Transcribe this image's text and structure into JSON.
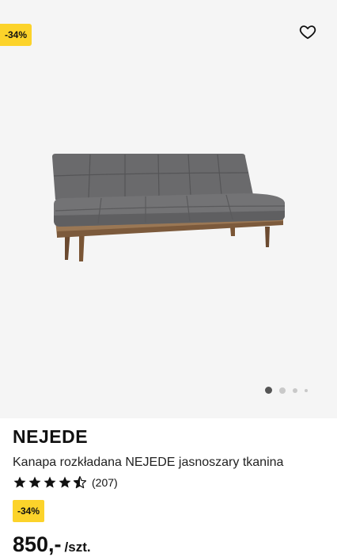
{
  "product": {
    "discount_badge": "-34%",
    "name": "NEJEDE",
    "description": "Kanapa rozkładana NEJEDE jasnoszary tkanina",
    "rating": 4.5,
    "review_count": "(207)",
    "price_badge": "-34%",
    "price": "850,-",
    "unit": "/szt."
  },
  "gallery": {
    "current_slide": 1,
    "slides": 4
  },
  "colors": {
    "badge": "#fcd32a",
    "hero_bg": "#f5f5f5"
  }
}
